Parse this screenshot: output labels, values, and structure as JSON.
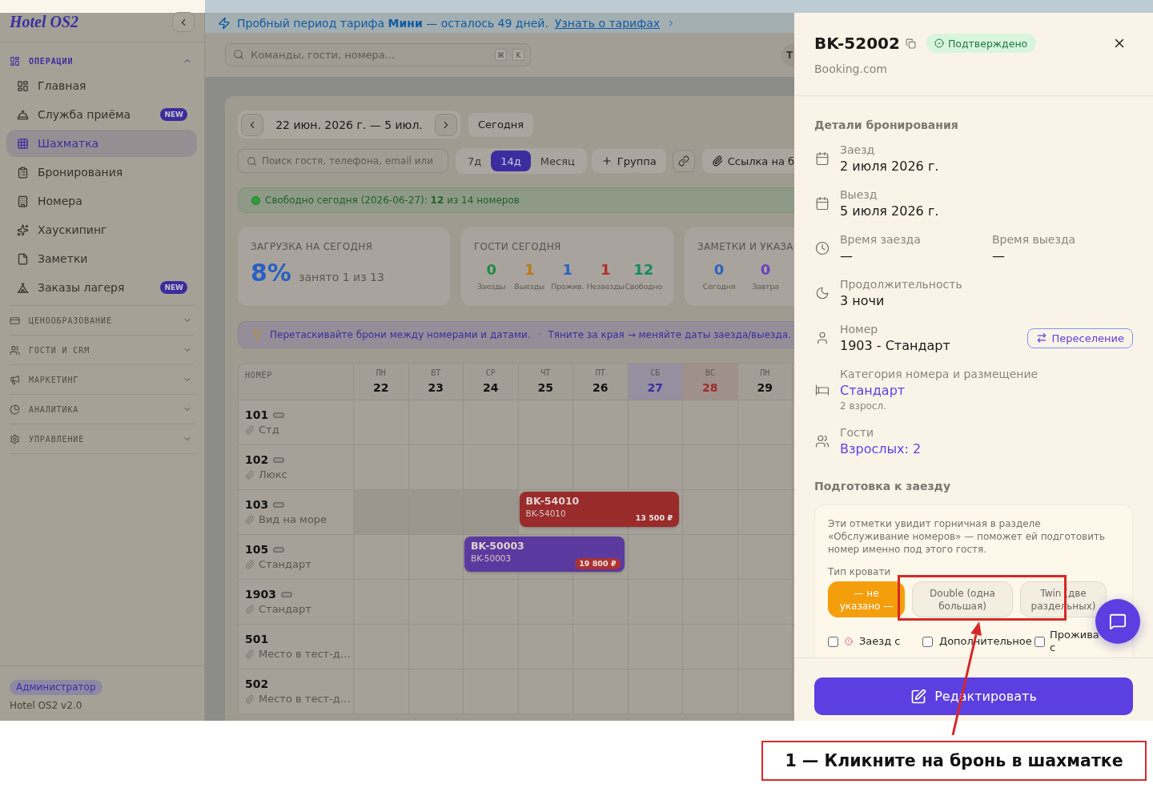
{
  "sidebar": {
    "logo": "Hotel OS2",
    "sections": [
      {
        "title": "ОПЕРАЦИИ",
        "expanded": true,
        "items": [
          {
            "label": "Главная",
            "selected": false
          },
          {
            "label": "Служба приёма",
            "selected": false,
            "badge": "NEW"
          },
          {
            "label": "Шахматка",
            "selected": true
          },
          {
            "label": "Бронирования",
            "selected": false
          },
          {
            "label": "Номера",
            "selected": false
          },
          {
            "label": "Хаускипинг",
            "selected": false
          },
          {
            "label": "Заметки",
            "selected": false
          },
          {
            "label": "Заказы лагеря",
            "selected": false,
            "badge": "NEW"
          }
        ]
      },
      {
        "title": "ЦЕНООБРАЗОВАНИЕ",
        "expanded": false
      },
      {
        "title": "ГОСТИ И CRM",
        "expanded": false
      },
      {
        "title": "МАРКЕТИНГ",
        "expanded": false
      },
      {
        "title": "АНАЛИТИКА",
        "expanded": false
      },
      {
        "title": "УПРАВЛЕНИЕ",
        "expanded": false
      }
    ],
    "role": "Администратор",
    "version": "Hotel OS2 v2.0"
  },
  "banner": {
    "text": "Пробный период тарифа **Мини** — осталось 49 дней.",
    "link": "Узнать о тарифах"
  },
  "header": {
    "search_placeholder": "Команды, гости, номера...",
    "shortcut": [
      "⌘",
      "K"
    ],
    "avatar": "Т"
  },
  "calendar": {
    "range": "22 июн. 2026 г. — 5 июл.",
    "today_button": "Сегодня",
    "search_placeholder": "Поиск гостя, телефона, email или",
    "views": [
      {
        "label": "7д",
        "selected": false
      },
      {
        "label": "14д",
        "selected": true
      },
      {
        "label": "Месяц",
        "selected": false
      }
    ],
    "actions": [
      {
        "kind": "add",
        "label": "Группа"
      },
      {
        "kind": "link"
      },
      {
        "kind": "attach",
        "label": "Ссылка на б"
      }
    ],
    "free_today": "Свободно сегодня (2026-06-27): **12** из 14 номеров",
    "stats": [
      {
        "kind": "load",
        "title": "ЗАГРУЗКА НА СЕГОДНЯ",
        "value": "8%",
        "caption": "занято 1 из 13"
      },
      {
        "kind": "counts",
        "title": "ГОСТИ СЕГОДНЯ",
        "counts": [
          {
            "value": "0",
            "label": "Заезды",
            "color": "#1e8a45"
          },
          {
            "value": "1",
            "label": "Выезды",
            "color": "#b7790f"
          },
          {
            "value": "1",
            "label": "Прожив.",
            "color": "#2a62c0"
          },
          {
            "value": "1",
            "label": "Незаезды",
            "color": "#b52b2b"
          },
          {
            "value": "12",
            "label": "Свободно",
            "color": "#158a63"
          }
        ]
      },
      {
        "kind": "counts",
        "title": "ЗАМЕТКИ И УКАЗА",
        "counts": [
          {
            "value": "0",
            "label": "Сегодня",
            "color": "#2a62c0"
          },
          {
            "value": "0",
            "label": "Завтра",
            "color": "#6a3fc0"
          }
        ]
      }
    ],
    "tips": {
      "items": [
        "Перетаскивайте брони между номерами и датами.",
        "Тяните за края → меняйте даты заезда/выезда."
      ],
      "separator": "·"
    },
    "room_header": "НОМЕР",
    "days": [
      {
        "weekday": "ПН",
        "date": "22",
        "kind": "weekday"
      },
      {
        "weekday": "ВТ",
        "date": "23",
        "kind": "weekday"
      },
      {
        "weekday": "СР",
        "date": "24",
        "kind": "weekday"
      },
      {
        "weekday": "ЧТ",
        "date": "25",
        "kind": "weekday"
      },
      {
        "weekday": "ПТ",
        "date": "26",
        "kind": "weekday"
      },
      {
        "weekday": "СБ",
        "date": "27",
        "kind": "today"
      },
      {
        "weekday": "ВС",
        "date": "28",
        "kind": "weekend"
      },
      {
        "weekday": "ПН",
        "date": "29",
        "kind": "weekday"
      }
    ],
    "rooms": [
      {
        "number": "101",
        "type": "Стд",
        "marker": true
      },
      {
        "number": "102",
        "type": "Люкс",
        "marker": true
      },
      {
        "number": "103",
        "type": "Вид на море",
        "marker": true,
        "cells": [
          {
            "kind": "blocked"
          },
          {
            "kind": "blocked"
          },
          {
            "kind": "blocked"
          },
          {
            "kind": "booking",
            "code": "BK-54010",
            "ref": "BK-54010",
            "price": "13 500 ₽",
            "price_badge": false,
            "color": "#9a2b2b"
          },
          {
            "kind": "continued"
          },
          {
            "kind": "continued"
          },
          {
            "kind": "free"
          },
          {
            "kind": "free"
          }
        ]
      },
      {
        "number": "105",
        "type": "Стандарт",
        "marker": true,
        "cells": [
          {
            "kind": "free"
          },
          {
            "kind": "free"
          },
          {
            "kind": "booking",
            "code": "BK-50003",
            "ref": "BK-50003",
            "price": "19 800 ₽",
            "price_badge": true,
            "color": "#5b3a9f"
          },
          {
            "kind": "continued"
          },
          {
            "kind": "continued"
          },
          {
            "kind": "free"
          },
          {
            "kind": "free"
          },
          {
            "kind": "free"
          }
        ]
      },
      {
        "number": "1903",
        "type": "Стандарт",
        "marker": true
      },
      {
        "number": "501",
        "type": "Место в тест-д…",
        "marker": false
      },
      {
        "number": "502",
        "type": "Место в тест-д…",
        "marker": false
      }
    ]
  },
  "drawer": {
    "code": "BK-52002",
    "status": {
      "label": "Подтверждено",
      "kind": "confirmed"
    },
    "source": "Booking.com",
    "details_title": "Детали бронирования",
    "details": [
      {
        "kind": "date",
        "label": "Заезд",
        "value": "2 июля 2026 г."
      },
      {
        "kind": "date",
        "label": "Выезд",
        "value": "5 июля 2026 г."
      },
      {
        "kind": "times",
        "items": [
          {
            "label": "Время заезда",
            "value": "—"
          },
          {
            "label": "Время выезда",
            "value": "—"
          }
        ]
      },
      {
        "kind": "duration",
        "label": "Продолжительность",
        "value": "3 ночи"
      },
      {
        "kind": "room",
        "label": "Номер",
        "value": "1903 - Стандарт",
        "action": "Переселение"
      },
      {
        "kind": "category",
        "label": "Категория номера и размещение",
        "value": "Стандарт",
        "note": "2 взросл."
      },
      {
        "kind": "guests",
        "label": "Гости",
        "value": "Взрослых: 2"
      }
    ],
    "prep_title": "Подготовка к заезду",
    "prep": {
      "note": "Эти отметки увидит горничная в разделе «Обслуживание номеров» — поможет ей подготовить номер именно под этого гостя.",
      "bed_label": "Тип кровати",
      "bed_options": [
        {
          "label": "— не указано —",
          "selected": true
        },
        {
          "label": "Double (одна большая)",
          "selected": false
        },
        {
          "label": "Twin (две раздельных)",
          "selected": false
        }
      ],
      "options": [
        {
          "label": "Заезд с",
          "checked": false,
          "warning": true
        },
        {
          "label": "Дополнительное",
          "checked": false,
          "warning": false
        },
        {
          "label": "Прожива с",
          "checked": false,
          "warning": false
        }
      ]
    },
    "edit_button": "Редактировать"
  },
  "annotation": {
    "text": "1 — Кликните на бронь в шахматке"
  }
}
